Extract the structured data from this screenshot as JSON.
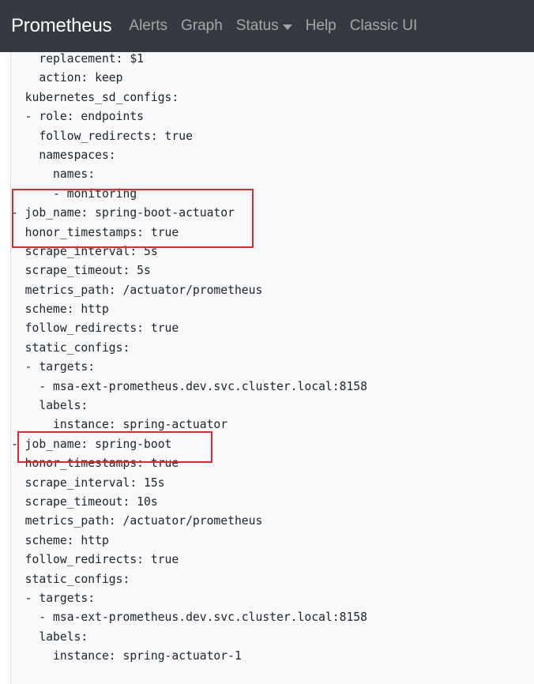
{
  "navbar": {
    "brand": "Prometheus",
    "items": [
      {
        "label": "Alerts"
      },
      {
        "label": "Graph"
      },
      {
        "label": "Status",
        "has_dropdown": true
      },
      {
        "label": "Help"
      },
      {
        "label": "Classic UI"
      }
    ]
  },
  "config": {
    "lines": [
      "    replacement: $1",
      "    action: keep",
      "  kubernetes_sd_configs:",
      "  - role: endpoints",
      "    follow_redirects: true",
      "    namespaces:",
      "      names:",
      "      - monitoring",
      "- job_name: spring-boot-actuator",
      "  honor_timestamps: true",
      "  scrape_interval: 5s",
      "  scrape_timeout: 5s",
      "  metrics_path: /actuator/prometheus",
      "  scheme: http",
      "  follow_redirects: true",
      "  static_configs:",
      "  - targets:",
      "    - msa-ext-prometheus.dev.svc.cluster.local:8158",
      "    labels:",
      "      instance: spring-actuator",
      "- job_name: spring-boot",
      "  honor_timestamps: true",
      "  scrape_interval: 15s",
      "  scrape_timeout: 10s",
      "  metrics_path: /actuator/prometheus",
      "  scheme: http",
      "  follow_redirects: true",
      "  static_configs:",
      "  - targets:",
      "    - msa-ext-prometheus.dev.svc.cluster.local:8158",
      "    labels:",
      "      instance: spring-actuator-1"
    ]
  },
  "highlight_color": "#e8262b"
}
